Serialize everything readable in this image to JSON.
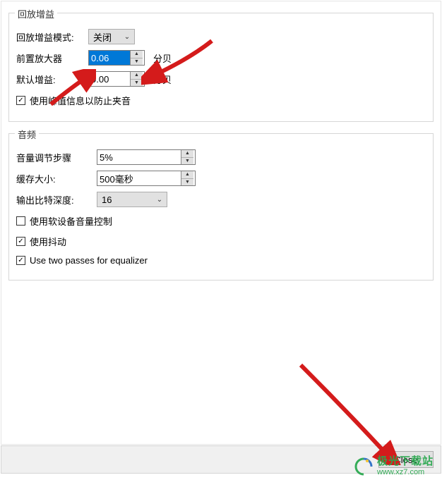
{
  "groups": {
    "replay": {
      "legend": "回放增益",
      "mode_label": "回放增益模式:",
      "mode_value": "关闭",
      "preamp_label": "前置放大器",
      "preamp_value": "0.06",
      "preamp_unit": "分贝",
      "default_gain_label": "默认增益:",
      "default_gain_value": "0.00",
      "default_gain_unit": "分贝",
      "peak_label": "使用峰值信息以防止夹音",
      "peak_checked": true
    },
    "audio": {
      "legend": "音频",
      "volstep_label": "音量调节步骤",
      "volstep_value": "5%",
      "buffer_label": "缓存大小:",
      "buffer_value": "500毫秒",
      "bitdepth_label": "输出比特深度:",
      "bitdepth_value": "16",
      "softvol_label": "使用软设备音量控制",
      "softvol_checked": false,
      "dither_label": "使用抖动",
      "dither_checked": true,
      "twopass_label": "Use two passes for equalizer",
      "twopass_checked": true
    }
  },
  "buttons": {
    "close": "Close"
  },
  "icons": {
    "check": "✓",
    "up": "▲",
    "down": "▼",
    "chev": "⌄"
  },
  "watermark": {
    "line1": "极光下载站",
    "line2": "www.xz7.com"
  }
}
